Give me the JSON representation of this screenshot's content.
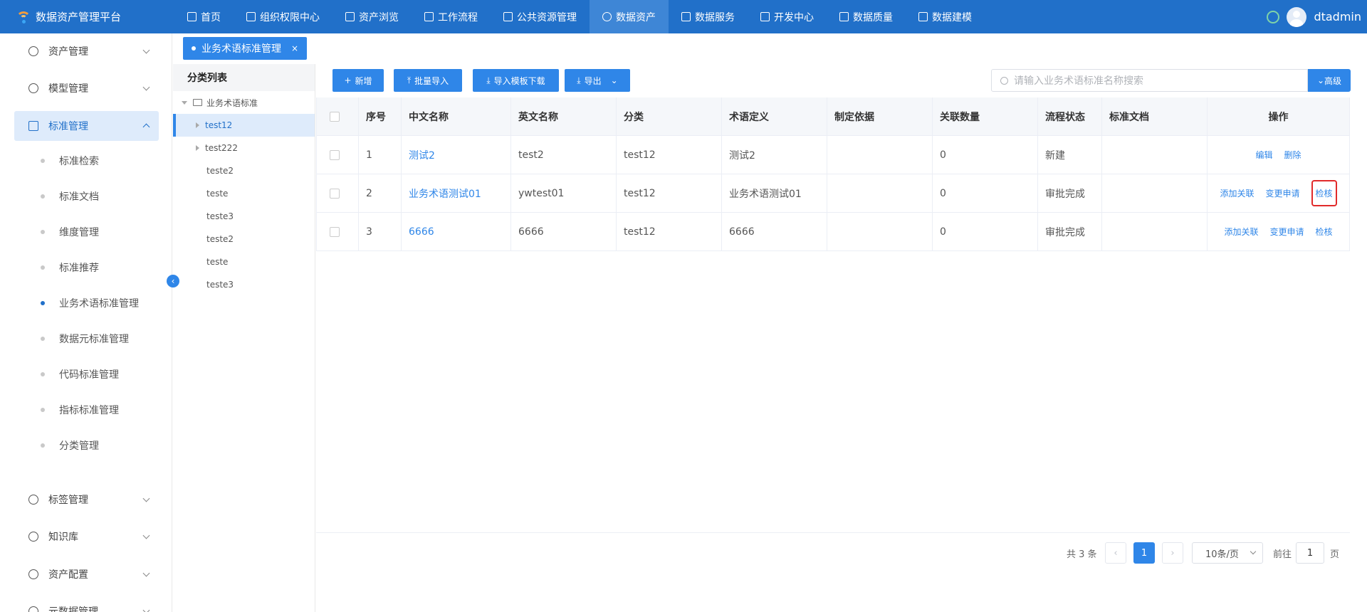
{
  "app": {
    "title": "数据资产管理平台"
  },
  "topnav": {
    "items": [
      {
        "label": "首页",
        "icon": "document-icon"
      },
      {
        "label": "组织权限中心",
        "icon": "shield-icon"
      },
      {
        "label": "资产浏览",
        "icon": "list-icon"
      },
      {
        "label": "工作流程",
        "icon": "scale-icon"
      },
      {
        "label": "公共资源管理",
        "icon": "people-icon"
      },
      {
        "label": "数据资产",
        "icon": "chat-icon",
        "active": true
      },
      {
        "label": "数据服务",
        "icon": "chart-icon"
      },
      {
        "label": "开发中心",
        "icon": "edit-icon"
      },
      {
        "label": "数据质量",
        "icon": "bar-chart-icon"
      },
      {
        "label": "数据建模",
        "icon": "layers-icon"
      }
    ],
    "username": "dtadmin"
  },
  "sidebar": {
    "items": [
      {
        "label": "资产管理",
        "icon": "clock-icon"
      },
      {
        "label": "模型管理",
        "icon": "trend-icon"
      },
      {
        "label": "标准管理",
        "icon": "document-icon",
        "open": true
      },
      {
        "label": "标签管理",
        "icon": "plus-circle-icon"
      },
      {
        "label": "知识库",
        "icon": "tag-icon"
      },
      {
        "label": "资产配置",
        "icon": "target-icon"
      },
      {
        "label": "元数据管理",
        "icon": "layers-icon"
      }
    ],
    "subitems": [
      {
        "label": "标准检索"
      },
      {
        "label": "标准文档"
      },
      {
        "label": "维度管理"
      },
      {
        "label": "标准推荐"
      },
      {
        "label": "业务术语标准管理",
        "active": true
      },
      {
        "label": "数据元标准管理"
      },
      {
        "label": "代码标准管理"
      },
      {
        "label": "指标标准管理"
      },
      {
        "label": "分类管理"
      }
    ]
  },
  "tabs": [
    {
      "label": "业务术语标准管理",
      "close": "×"
    }
  ],
  "category": {
    "title": "分类列表",
    "root": "业务术语标准",
    "nodes": [
      {
        "label": "test12",
        "expandable": true,
        "selected": true
      },
      {
        "label": "test222",
        "expandable": true
      },
      {
        "label": "teste2"
      },
      {
        "label": "teste"
      },
      {
        "label": "teste3"
      },
      {
        "label": "teste2"
      },
      {
        "label": "teste"
      },
      {
        "label": "teste3"
      }
    ]
  },
  "toolbar": {
    "add": "新增",
    "batch_import": "批量导入",
    "template_download": "导入模板下载",
    "export": "导出",
    "search_placeholder": "请输入业务术语标准名称搜索",
    "advanced": "高级"
  },
  "table": {
    "headers": [
      "序号",
      "中文名称",
      "英文名称",
      "分类",
      "术语定义",
      "制定依据",
      "关联数量",
      "流程状态",
      "标准文档",
      "操作"
    ],
    "rows": [
      {
        "no": "1",
        "cn": "测试2",
        "en": "test2",
        "category": "test12",
        "definition": "测试2",
        "basis": "",
        "count": "0",
        "status": "新建",
        "doc": "",
        "ops": [
          "编辑",
          "删除"
        ]
      },
      {
        "no": "2",
        "cn": "业务术语测试01",
        "en": "ywtest01",
        "category": "test12",
        "definition": "业务术语测试01",
        "basis": "",
        "count": "0",
        "status": "审批完成",
        "doc": "",
        "ops": [
          "添加关联",
          "变更申请",
          "检核"
        ]
      },
      {
        "no": "3",
        "cn": "6666",
        "en": "6666",
        "category": "test12",
        "definition": "6666",
        "basis": "",
        "count": "0",
        "status": "审批完成",
        "doc": "",
        "ops": [
          "添加关联",
          "变更申请",
          "检核"
        ]
      }
    ]
  },
  "pagination": {
    "total": "共 3 条",
    "current": "1",
    "page_size": "10条/页",
    "goto_prefix": "前往",
    "goto_value": "1",
    "goto_suffix": "页"
  }
}
